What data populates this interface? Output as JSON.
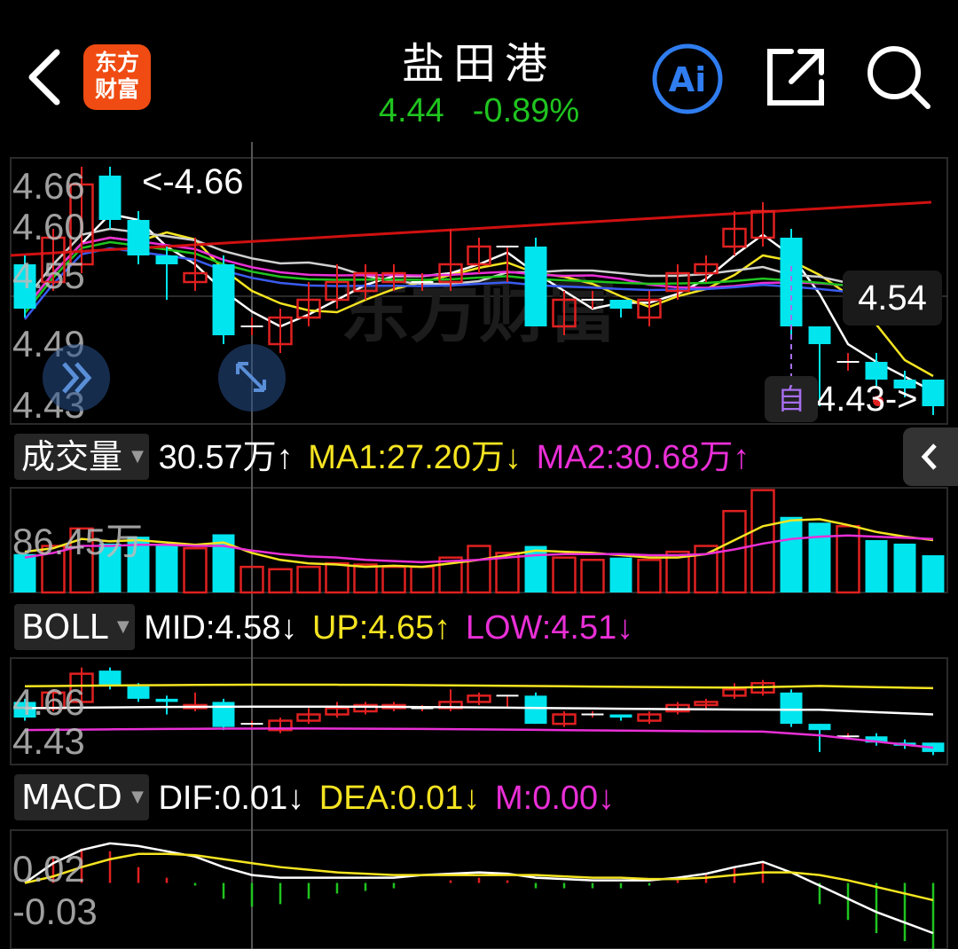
{
  "header": {
    "logo_line1": "东方",
    "logo_line2": "财富",
    "title": "盐田港",
    "price": "4.44",
    "change": "-0.89%"
  },
  "colors": {
    "up": "#e02020",
    "down": "#00e5ee",
    "green": "#1fc41f",
    "yellow": "#f5e421",
    "magenta": "#e92fd6",
    "white": "#ffffff",
    "blue": "#3a5cf0",
    "red_ma": "#d01010"
  },
  "kline": {
    "high_label": "<-4.66",
    "last_label": "4.54",
    "low_label": "4.43->",
    "self_button": "自",
    "axis_labels": [
      "4.66",
      "4.60",
      "4.55",
      "4.49",
      "4.43"
    ]
  },
  "volume": {
    "selector": "成交量",
    "current": "30.57万↑",
    "ma1": "MA1:27.20万↓",
    "ma2": "MA2:30.68万↑",
    "axis_label": "86.45万"
  },
  "boll": {
    "selector": "BOLL",
    "mid": "MID:4.58↓",
    "up": "UP:4.65↑",
    "low": "LOW:4.51↓",
    "axis_labels": [
      "4.66",
      "4.43"
    ]
  },
  "macd": {
    "selector": "MACD",
    "dif": "DIF:0.01↓",
    "dea": "DEA:0.01↓",
    "m": "M:0.00↓",
    "axis_labels": [
      "0.02",
      "-0.03"
    ]
  },
  "candles": [
    {
      "o": 4.6,
      "c": 4.55,
      "h": 4.61,
      "l": 4.54
    },
    {
      "o": 4.58,
      "c": 4.63,
      "h": 4.64,
      "l": 4.57
    },
    {
      "o": 4.6,
      "c": 4.69,
      "h": 4.71,
      "l": 4.59
    },
    {
      "o": 4.7,
      "c": 4.65,
      "h": 4.71,
      "l": 4.64
    },
    {
      "o": 4.65,
      "c": 4.61,
      "h": 4.66,
      "l": 4.6
    },
    {
      "o": 4.61,
      "c": 4.6,
      "h": 4.62,
      "l": 4.56
    },
    {
      "o": 4.58,
      "c": 4.59,
      "h": 4.63,
      "l": 4.57
    },
    {
      "o": 4.6,
      "c": 4.52,
      "h": 4.61,
      "l": 4.51
    },
    {
      "o": 4.53,
      "c": 4.53,
      "h": 4.54,
      "l": 4.52
    },
    {
      "o": 4.51,
      "c": 4.54,
      "h": 4.55,
      "l": 4.5
    },
    {
      "o": 4.54,
      "c": 4.56,
      "h": 4.58,
      "l": 4.53
    },
    {
      "o": 4.56,
      "c": 4.58,
      "h": 4.6,
      "l": 4.55
    },
    {
      "o": 4.57,
      "c": 4.59,
      "h": 4.6,
      "l": 4.56
    },
    {
      "o": 4.58,
      "c": 4.59,
      "h": 4.6,
      "l": 4.57
    },
    {
      "o": 4.58,
      "c": 4.58,
      "h": 4.59,
      "l": 4.57
    },
    {
      "o": 4.58,
      "c": 4.6,
      "h": 4.64,
      "l": 4.57
    },
    {
      "o": 4.6,
      "c": 4.62,
      "h": 4.63,
      "l": 4.59
    },
    {
      "o": 4.62,
      "c": 4.62,
      "h": 4.62,
      "l": 4.58
    },
    {
      "o": 4.62,
      "c": 4.53,
      "h": 4.63,
      "l": 4.53
    },
    {
      "o": 4.53,
      "c": 4.56,
      "h": 4.57,
      "l": 4.52
    },
    {
      "o": 4.56,
      "c": 4.56,
      "h": 4.57,
      "l": 4.55
    },
    {
      "o": 4.56,
      "c": 4.55,
      "h": 4.56,
      "l": 4.54
    },
    {
      "o": 4.54,
      "c": 4.56,
      "h": 4.57,
      "l": 4.53
    },
    {
      "o": 4.57,
      "c": 4.59,
      "h": 4.6,
      "l": 4.56
    },
    {
      "o": 4.59,
      "c": 4.6,
      "h": 4.61,
      "l": 4.58
    },
    {
      "o": 4.62,
      "c": 4.64,
      "h": 4.66,
      "l": 4.61
    },
    {
      "o": 4.63,
      "c": 4.66,
      "h": 4.67,
      "l": 4.62
    },
    {
      "o": 4.63,
      "c": 4.53,
      "h": 4.64,
      "l": 4.52
    },
    {
      "o": 4.53,
      "c": 4.51,
      "h": 4.53,
      "l": 4.44
    },
    {
      "o": 4.49,
      "c": 4.49,
      "h": 4.5,
      "l": 4.48
    },
    {
      "o": 4.49,
      "c": 4.47,
      "h": 4.5,
      "l": 4.46
    },
    {
      "o": 4.47,
      "c": 4.46,
      "h": 4.48,
      "l": 4.45
    },
    {
      "o": 4.47,
      "c": 4.44,
      "h": 4.47,
      "l": 4.43
    }
  ],
  "volumes": [
    33,
    40,
    55,
    42,
    48,
    42,
    38,
    50,
    22,
    20,
    22,
    25,
    24,
    22,
    22,
    30,
    40,
    34,
    40,
    30,
    28,
    30,
    28,
    35,
    40,
    70,
    88,
    65,
    60,
    57,
    45,
    42,
    32
  ],
  "vol_ma1": [
    35,
    38,
    46,
    44,
    45,
    43,
    41,
    43,
    34,
    28,
    25,
    24,
    22,
    23,
    22,
    25,
    28,
    32,
    36,
    35,
    34,
    32,
    30,
    30,
    33,
    45,
    57,
    62,
    63,
    58,
    52,
    48,
    45
  ],
  "vol_ma2": [
    30,
    34,
    40,
    40,
    41,
    41,
    40,
    40,
    36,
    33,
    31,
    30,
    28,
    27,
    26,
    27,
    28,
    30,
    32,
    33,
    33,
    33,
    32,
    32,
    33,
    37,
    42,
    46,
    48,
    49,
    48,
    47,
    46
  ],
  "macd_dif": [
    0.0,
    0.015,
    0.025,
    0.03,
    0.028,
    0.024,
    0.02,
    0.012,
    0.006,
    0.004,
    0.004,
    0.004,
    0.004,
    0.004,
    0.006,
    0.007,
    0.008,
    0.007,
    0.004,
    0.003,
    0.002,
    0.002,
    0.002,
    0.004,
    0.007,
    0.012,
    0.016,
    0.008,
    -0.002,
    -0.012,
    -0.022,
    -0.03,
    -0.038
  ],
  "macd_dea": [
    0.0,
    0.005,
    0.012,
    0.018,
    0.022,
    0.022,
    0.021,
    0.018,
    0.015,
    0.012,
    0.01,
    0.008,
    0.007,
    0.006,
    0.006,
    0.006,
    0.006,
    0.006,
    0.006,
    0.005,
    0.004,
    0.004,
    0.003,
    0.003,
    0.004,
    0.006,
    0.008,
    0.008,
    0.006,
    0.002,
    -0.003,
    -0.008,
    -0.013
  ]
}
